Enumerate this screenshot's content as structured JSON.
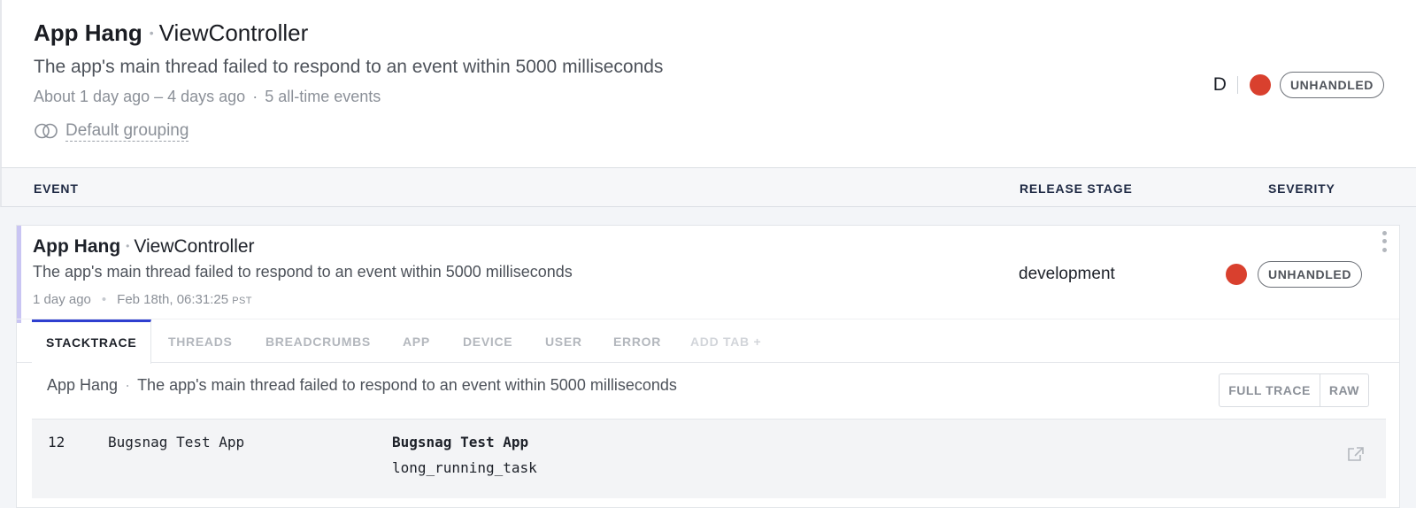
{
  "header": {
    "error_class": "App Hang",
    "context": "ViewController",
    "message": "The app's main thread failed to respond to an event within 5000 milliseconds",
    "time_range": "About 1 day ago – 4 days ago",
    "events_count": "5 all-time events",
    "grouping_label": "Default grouping",
    "grouping_icon": "grouping-rings-icon",
    "assignee_letter": "D",
    "severity_color": "#d9402e",
    "handled_badge": "UNHANDLED"
  },
  "columns": {
    "event": "EVENT",
    "release_stage": "RELEASE STAGE",
    "severity": "SEVERITY"
  },
  "event": {
    "error_class": "App Hang",
    "context": "ViewController",
    "message": "The app's main thread failed to respond to an event within 5000 milliseconds",
    "relative_time": "1 day ago",
    "timestamp": "Feb 18th, 06:31:25",
    "timezone": "PST",
    "release_stage": "development",
    "severity_color": "#d9402e",
    "handled_badge": "UNHANDLED",
    "accent_color": "#c9c5f3"
  },
  "tabs": [
    {
      "label": "STACKTRACE",
      "active": true
    },
    {
      "label": "THREADS"
    },
    {
      "label": "BREADCRUMBS"
    },
    {
      "label": "APP"
    },
    {
      "label": "DEVICE"
    },
    {
      "label": "USER"
    },
    {
      "label": "ERROR"
    },
    {
      "label": "ADD TAB +"
    }
  ],
  "stacktrace": {
    "error_class": "App Hang",
    "message": "The app's main thread failed to respond to an event within 5000 milliseconds",
    "full_trace_label": "FULL TRACE",
    "raw_label": "RAW",
    "frames": [
      {
        "number": "12",
        "library": "Bugsnag Test App",
        "function_lib": "Bugsnag Test App",
        "function_name": "long_running_task",
        "action_icon": "external-link-icon"
      }
    ]
  },
  "accent_color": "#2f3fd0"
}
